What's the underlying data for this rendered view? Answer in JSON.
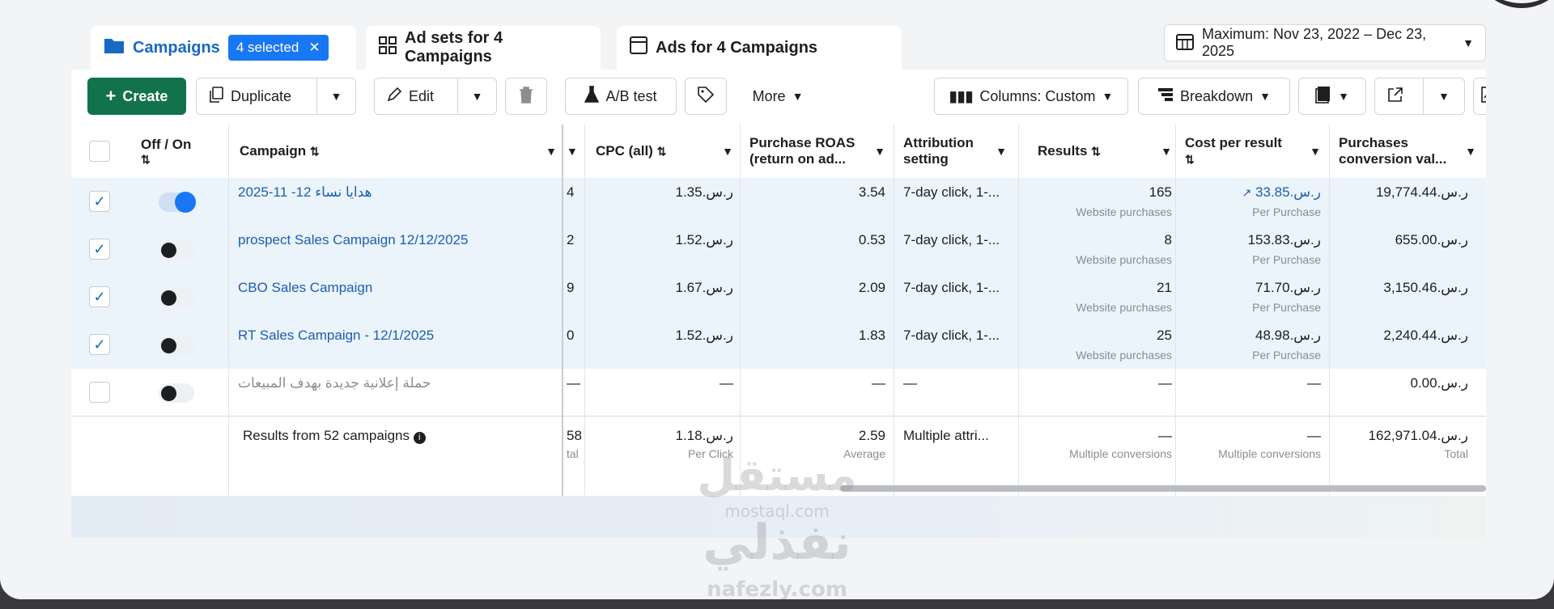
{
  "tabs": {
    "campaigns_label": "Campaigns",
    "selected_label": "4 selected",
    "adsets_label": "Ad sets for 4 Campaigns",
    "ads_label": "Ads for 4 Campaigns"
  },
  "date_range": "Maximum: Nov 23, 2022 – Dec 23, 2025",
  "toolbar": {
    "create": "Create",
    "duplicate": "Duplicate",
    "edit": "Edit",
    "ab_test": "A/B test",
    "more": "More",
    "columns": "Columns: Custom",
    "breakdown": "Breakdown"
  },
  "headers": {
    "off_on": "Off / On",
    "campaign": "Campaign",
    "cpc": "CPC (all)",
    "roas_l1": "Purchase ROAS",
    "roas_l2": "(return on ad...",
    "attr_l1": "Attribution",
    "attr_l2": "setting",
    "results": "Results",
    "cpr": "Cost per result",
    "pcv_l1": "Purchases",
    "pcv_l2": "conversion val..."
  },
  "rows": [
    {
      "name": "هدايا نساء 12- 11-2025",
      "hidden": "4",
      "cpc": "ر.س.1.35",
      "roas": "3.54",
      "attribution": "7-day click, 1-...",
      "results": "165",
      "results_sub": "Website purchases",
      "cpr": "ر.س.33.85",
      "cpr_sub": "Per Purchase",
      "pcv": "ر.س.19,774.44"
    },
    {
      "name": "prospect Sales Campaign 12/12/2025",
      "hidden": "2",
      "cpc": "ر.س.1.52",
      "roas": "0.53",
      "attribution": "7-day click, 1-...",
      "results": "8",
      "results_sub": "Website purchases",
      "cpr": "ر.س.153.83",
      "cpr_sub": "Per Purchase",
      "pcv": "ر.س.655.00"
    },
    {
      "name": "CBO Sales Campaign",
      "hidden": "9",
      "cpc": "ر.س.1.67",
      "roas": "2.09",
      "attribution": "7-day click, 1-...",
      "results": "21",
      "results_sub": "Website purchases",
      "cpr": "ر.س.71.70",
      "cpr_sub": "Per Purchase",
      "pcv": "ر.س.3,150.46"
    },
    {
      "name": "RT Sales Campaign - 12/1/2025",
      "hidden": "0",
      "cpc": "ر.س.1.52",
      "roas": "1.83",
      "attribution": "7-day click, 1-...",
      "results": "25",
      "results_sub": "Website purchases",
      "cpr": "ر.س.48.98",
      "cpr_sub": "Per Purchase",
      "pcv": "ر.س.2,240.44"
    },
    {
      "name": "حملة إعلانية جديدة بهدف المبيعات",
      "hidden": "—",
      "cpc": "—",
      "roas": "—",
      "attribution": "—",
      "results": "—",
      "results_sub": "",
      "cpr": "—",
      "cpr_sub": "",
      "pcv": "ر.س.0.00"
    }
  ],
  "summary": {
    "label": "Results from 52 campaigns",
    "hidden": "58",
    "hidden_sub": "tal",
    "cpc": "ر.س.1.18",
    "cpc_sub": "Per Click",
    "roas": "2.59",
    "roas_sub": "Average",
    "attribution": "Multiple attri...",
    "results": "—",
    "results_sub": "Multiple conversions",
    "cpr": "—",
    "cpr_sub": "Multiple conversions",
    "pcv": "ر.س.162,971.04",
    "pcv_sub": "Total"
  },
  "watermark": {
    "line1": "مستقل",
    "line2": "mostaql.com",
    "line3": "نفذلي",
    "line4": "nafezly.com"
  }
}
